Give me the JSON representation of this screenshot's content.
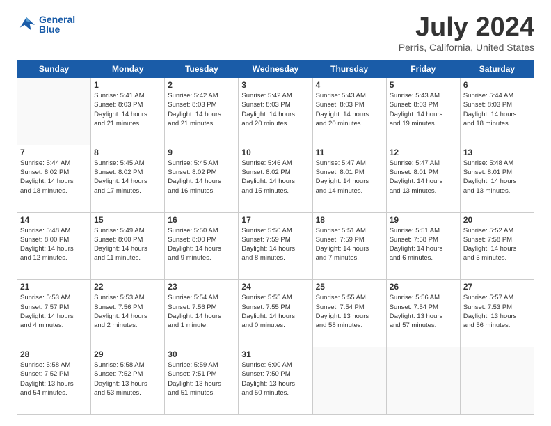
{
  "header": {
    "logo_line1": "General",
    "logo_line2": "Blue",
    "main_title": "July 2024",
    "subtitle": "Perris, California, United States"
  },
  "days_of_week": [
    "Sunday",
    "Monday",
    "Tuesday",
    "Wednesday",
    "Thursday",
    "Friday",
    "Saturday"
  ],
  "weeks": [
    [
      {
        "day": "",
        "info": ""
      },
      {
        "day": "1",
        "info": "Sunrise: 5:41 AM\nSunset: 8:03 PM\nDaylight: 14 hours\nand 21 minutes."
      },
      {
        "day": "2",
        "info": "Sunrise: 5:42 AM\nSunset: 8:03 PM\nDaylight: 14 hours\nand 21 minutes."
      },
      {
        "day": "3",
        "info": "Sunrise: 5:42 AM\nSunset: 8:03 PM\nDaylight: 14 hours\nand 20 minutes."
      },
      {
        "day": "4",
        "info": "Sunrise: 5:43 AM\nSunset: 8:03 PM\nDaylight: 14 hours\nand 20 minutes."
      },
      {
        "day": "5",
        "info": "Sunrise: 5:43 AM\nSunset: 8:03 PM\nDaylight: 14 hours\nand 19 minutes."
      },
      {
        "day": "6",
        "info": "Sunrise: 5:44 AM\nSunset: 8:03 PM\nDaylight: 14 hours\nand 18 minutes."
      }
    ],
    [
      {
        "day": "7",
        "info": "Sunrise: 5:44 AM\nSunset: 8:02 PM\nDaylight: 14 hours\nand 18 minutes."
      },
      {
        "day": "8",
        "info": "Sunrise: 5:45 AM\nSunset: 8:02 PM\nDaylight: 14 hours\nand 17 minutes."
      },
      {
        "day": "9",
        "info": "Sunrise: 5:45 AM\nSunset: 8:02 PM\nDaylight: 14 hours\nand 16 minutes."
      },
      {
        "day": "10",
        "info": "Sunrise: 5:46 AM\nSunset: 8:02 PM\nDaylight: 14 hours\nand 15 minutes."
      },
      {
        "day": "11",
        "info": "Sunrise: 5:47 AM\nSunset: 8:01 PM\nDaylight: 14 hours\nand 14 minutes."
      },
      {
        "day": "12",
        "info": "Sunrise: 5:47 AM\nSunset: 8:01 PM\nDaylight: 14 hours\nand 13 minutes."
      },
      {
        "day": "13",
        "info": "Sunrise: 5:48 AM\nSunset: 8:01 PM\nDaylight: 14 hours\nand 13 minutes."
      }
    ],
    [
      {
        "day": "14",
        "info": "Sunrise: 5:48 AM\nSunset: 8:00 PM\nDaylight: 14 hours\nand 12 minutes."
      },
      {
        "day": "15",
        "info": "Sunrise: 5:49 AM\nSunset: 8:00 PM\nDaylight: 14 hours\nand 11 minutes."
      },
      {
        "day": "16",
        "info": "Sunrise: 5:50 AM\nSunset: 8:00 PM\nDaylight: 14 hours\nand 9 minutes."
      },
      {
        "day": "17",
        "info": "Sunrise: 5:50 AM\nSunset: 7:59 PM\nDaylight: 14 hours\nand 8 minutes."
      },
      {
        "day": "18",
        "info": "Sunrise: 5:51 AM\nSunset: 7:59 PM\nDaylight: 14 hours\nand 7 minutes."
      },
      {
        "day": "19",
        "info": "Sunrise: 5:51 AM\nSunset: 7:58 PM\nDaylight: 14 hours\nand 6 minutes."
      },
      {
        "day": "20",
        "info": "Sunrise: 5:52 AM\nSunset: 7:58 PM\nDaylight: 14 hours\nand 5 minutes."
      }
    ],
    [
      {
        "day": "21",
        "info": "Sunrise: 5:53 AM\nSunset: 7:57 PM\nDaylight: 14 hours\nand 4 minutes."
      },
      {
        "day": "22",
        "info": "Sunrise: 5:53 AM\nSunset: 7:56 PM\nDaylight: 14 hours\nand 2 minutes."
      },
      {
        "day": "23",
        "info": "Sunrise: 5:54 AM\nSunset: 7:56 PM\nDaylight: 14 hours\nand 1 minute."
      },
      {
        "day": "24",
        "info": "Sunrise: 5:55 AM\nSunset: 7:55 PM\nDaylight: 14 hours\nand 0 minutes."
      },
      {
        "day": "25",
        "info": "Sunrise: 5:55 AM\nSunset: 7:54 PM\nDaylight: 13 hours\nand 58 minutes."
      },
      {
        "day": "26",
        "info": "Sunrise: 5:56 AM\nSunset: 7:54 PM\nDaylight: 13 hours\nand 57 minutes."
      },
      {
        "day": "27",
        "info": "Sunrise: 5:57 AM\nSunset: 7:53 PM\nDaylight: 13 hours\nand 56 minutes."
      }
    ],
    [
      {
        "day": "28",
        "info": "Sunrise: 5:58 AM\nSunset: 7:52 PM\nDaylight: 13 hours\nand 54 minutes."
      },
      {
        "day": "29",
        "info": "Sunrise: 5:58 AM\nSunset: 7:52 PM\nDaylight: 13 hours\nand 53 minutes."
      },
      {
        "day": "30",
        "info": "Sunrise: 5:59 AM\nSunset: 7:51 PM\nDaylight: 13 hours\nand 51 minutes."
      },
      {
        "day": "31",
        "info": "Sunrise: 6:00 AM\nSunset: 7:50 PM\nDaylight: 13 hours\nand 50 minutes."
      },
      {
        "day": "",
        "info": ""
      },
      {
        "day": "",
        "info": ""
      },
      {
        "day": "",
        "info": ""
      }
    ]
  ]
}
